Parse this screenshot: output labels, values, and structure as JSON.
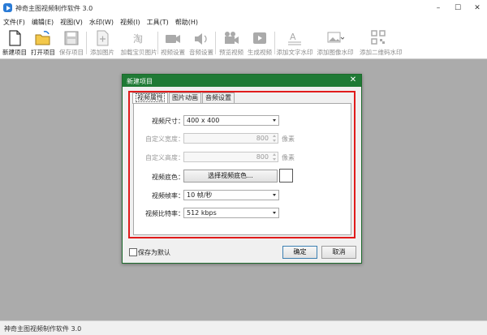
{
  "window": {
    "title": "神奇主图视频制作软件 3.0"
  },
  "menu": [
    "文件(F)",
    "编辑(E)",
    "视图(V)",
    "水印(W)",
    "视频(I)",
    "工具(T)",
    "帮助(H)"
  ],
  "toolbar": [
    {
      "label": "新建项目",
      "icon": "new-project-icon",
      "enabled": true
    },
    {
      "label": "打开项目",
      "icon": "open-project-icon",
      "enabled": true
    },
    {
      "label": "保存项目",
      "icon": "save-project-icon",
      "enabled": false
    },
    {
      "label": "添加图片",
      "icon": "add-image-icon",
      "enabled": false
    },
    {
      "label": "加载宝贝图片",
      "icon": "load-product-images-icon",
      "enabled": false
    },
    {
      "label": "视频设置",
      "icon": "video-settings-icon",
      "enabled": false
    },
    {
      "label": "音频设置",
      "icon": "audio-settings-icon",
      "enabled": false
    },
    {
      "label": "预览视频",
      "icon": "preview-video-icon",
      "enabled": false
    },
    {
      "label": "生成视频",
      "icon": "generate-video-icon",
      "enabled": false
    },
    {
      "label": "添加文字水印",
      "icon": "text-watermark-icon",
      "enabled": false
    },
    {
      "label": "添加图像水印",
      "icon": "image-watermark-icon",
      "enabled": false
    },
    {
      "label": "添加二维码水印",
      "icon": "qrcode-watermark-icon",
      "enabled": false
    }
  ],
  "status": {
    "text": "神奇主图视频制作软件 3.0"
  },
  "dialog": {
    "title": "新建项目",
    "close_glyph": "✕",
    "tabs": [
      "视频属性",
      "图片动画",
      "音频设置"
    ],
    "active_tab": 0,
    "fields": {
      "video_size": {
        "label": "视频尺寸：",
        "value": "400 x 400"
      },
      "custom_width": {
        "label": "自定义宽度：",
        "value": "800",
        "unit": "像素"
      },
      "custom_height": {
        "label": "自定义高度：",
        "value": "800",
        "unit": "像素"
      },
      "bg_color": {
        "label": "视频底色：",
        "button": "选择视频底色...",
        "color": "#ffffff"
      },
      "frame_rate": {
        "label": "视频帧率：",
        "value": "10 帧/秒"
      },
      "bitrate": {
        "label": "视频比特率：",
        "value": "512 kbps"
      }
    },
    "save_default": {
      "label": "保存为默认",
      "checked": false
    },
    "ok": "确定",
    "cancel": "取消"
  },
  "colors": {
    "dialog_title_bg": "#1f7a35",
    "highlight_frame": "#e01b1b",
    "workspace": "#ababab",
    "app_icon": "#2a7bd6"
  }
}
